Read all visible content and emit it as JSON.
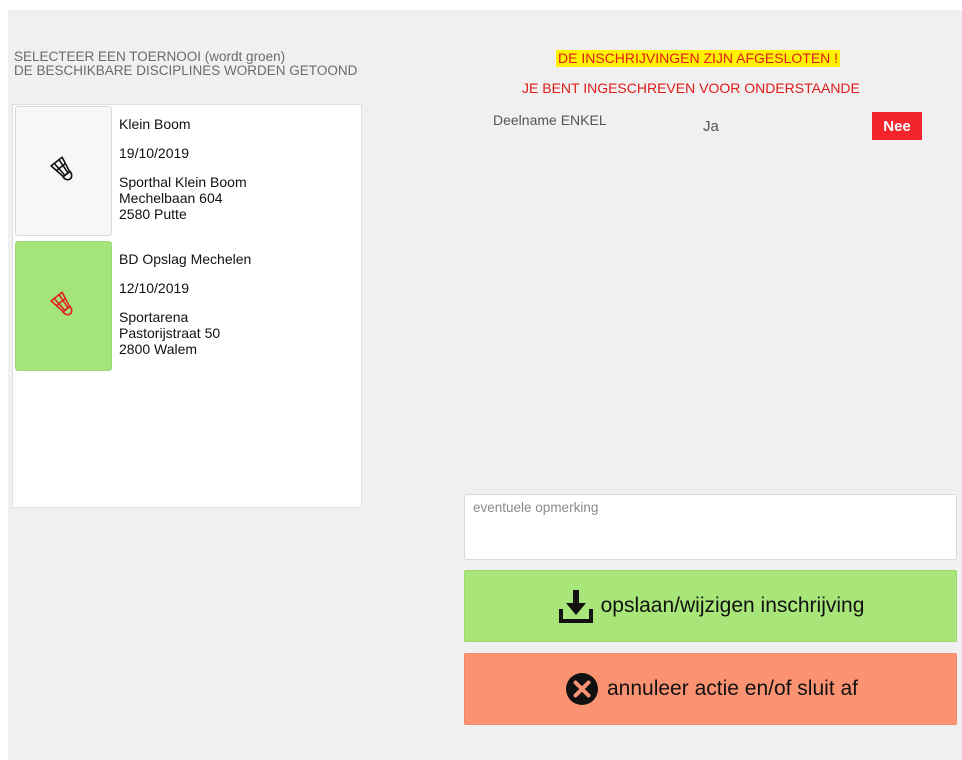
{
  "instructions": {
    "line1": "SELECTEER EEN TOERNOOI (wordt groen)",
    "line2": "DE BESCHIKBARE DISCIPLINES WORDEN GETOOND"
  },
  "tournaments": [
    {
      "name": "Klein Boom",
      "date": "19/10/2019",
      "venue": "Sporthal Klein Boom",
      "street": "Mechelbaan 604",
      "city": "2580 Putte",
      "selected": false,
      "icon": "shuttlecock-icon",
      "icon_color": "#111111"
    },
    {
      "name": "BD Opslag Mechelen",
      "date": "12/10/2019",
      "venue": "Sportarena",
      "street": "Pastorijstraat 50",
      "city": "2800 Walem",
      "selected": true,
      "icon": "shuttlecock-icon",
      "icon_color": "#e02020"
    }
  ],
  "status": {
    "closed": "DE INSCHRIJVINGEN ZIJN AFGESLOTEN !",
    "registered": "JE BENT INGESCHREVEN VOOR ONDERSTAANDE"
  },
  "disciplines": [
    {
      "label": "Deelname ENKEL",
      "yes": "Ja",
      "no": "Nee",
      "selected": "Nee"
    }
  ],
  "remark": {
    "placeholder": "eventuele opmerking",
    "value": ""
  },
  "buttons": {
    "save": "opslaan/wijzigen inschrijving",
    "cancel": "annuleer actie en/of sluit af"
  },
  "colors": {
    "selected_green": "#a4e47a",
    "save_green": "#a8e67a",
    "cancel_orange": "#fb9373",
    "no_red": "#f3242b",
    "banner_yellow": "#fff200",
    "text_red": "#e01b1b"
  }
}
